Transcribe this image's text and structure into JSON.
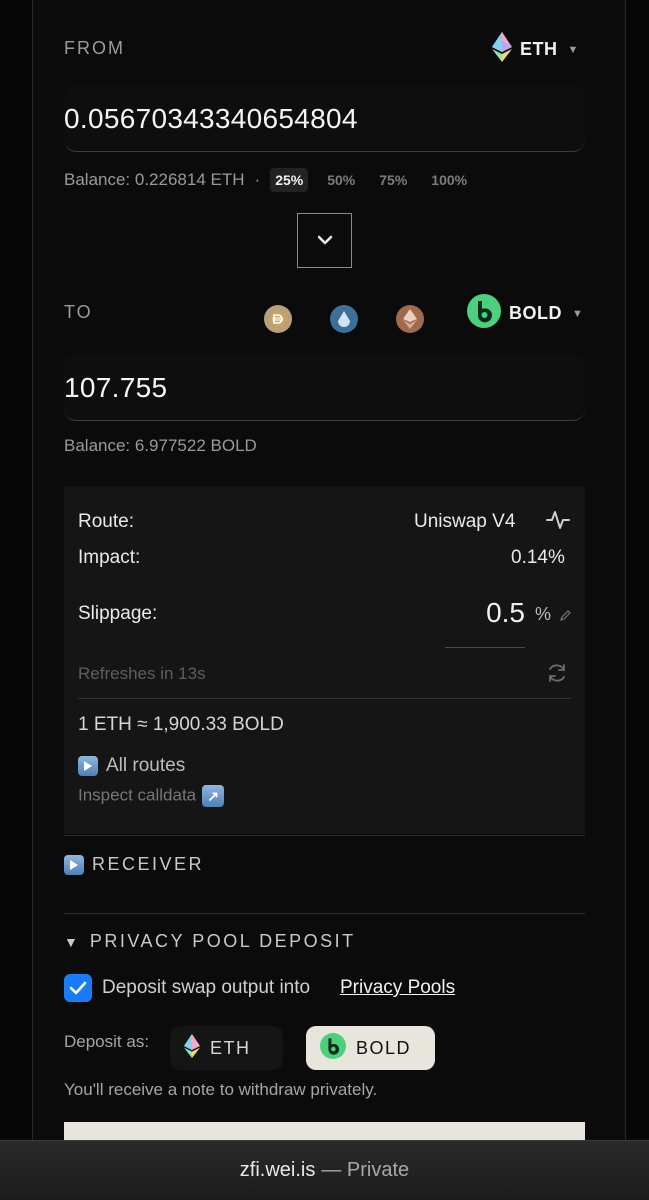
{
  "from": {
    "label": "FROM",
    "token": "ETH",
    "amount": "0.05670343340654804",
    "balance": "Balance: 0.226814 ETH",
    "sep": "·",
    "percents": [
      "25%",
      "50%",
      "75%",
      "100%"
    ],
    "active_percent": "25%"
  },
  "to": {
    "label": "TO",
    "token": "BOLD",
    "amount": "107.755",
    "balance": "Balance: 6.977522 BOLD",
    "quick_tokens": [
      "dai-icon",
      "lido-icon",
      "steth-icon"
    ]
  },
  "details": {
    "route_label": "Route:",
    "route_value": "Uniswap V4",
    "impact_label": "Impact:",
    "impact_value": "0.14%",
    "slippage_label": "Slippage:",
    "slippage_value": "0.5",
    "slippage_unit": "%",
    "refresh_text": "Refreshes in 13s",
    "rate": "1 ETH ≈ 1,900.33 BOLD",
    "all_routes": "All routes",
    "inspect": "Inspect calldata"
  },
  "receiver": {
    "label": "RECEIVER"
  },
  "privacy": {
    "toggle": "▼",
    "title": "PRIVACY POOL DEPOSIT",
    "checkbox_text": "Deposit swap output into",
    "checkbox_link": "Privacy Pools",
    "checked": true,
    "deposit_as_label": "Deposit as:",
    "options": [
      "ETH",
      "BOLD"
    ],
    "selected": "BOLD",
    "note": "You'll receive a note to withdraw privately."
  },
  "footer": {
    "domain": "zfi.wei.is",
    "status": "— Private"
  },
  "colors": {
    "accent": "#1a7cf5",
    "bold_green": "#4cd07d",
    "selected_pill": "#e8e6dc"
  }
}
